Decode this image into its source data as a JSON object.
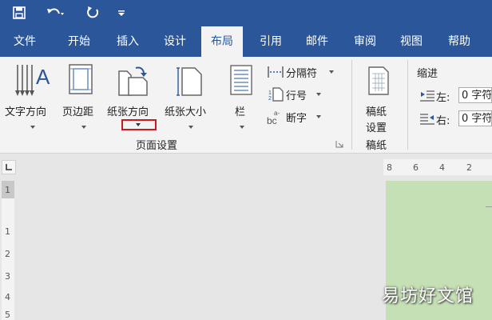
{
  "quick_access": {
    "save_icon": "save-icon",
    "undo_icon": "undo-icon",
    "redo_icon": "redo-icon",
    "customize_icon": "customize-dropdown-icon"
  },
  "tabs": [
    {
      "label": "文件"
    },
    {
      "label": "开始"
    },
    {
      "label": "插入"
    },
    {
      "label": "设计"
    },
    {
      "label": "布局",
      "active": true
    },
    {
      "label": "引用"
    },
    {
      "label": "邮件"
    },
    {
      "label": "审阅"
    },
    {
      "label": "视图"
    },
    {
      "label": "帮助"
    }
  ],
  "ribbon": {
    "page_setup": {
      "text_direction": "文字方向",
      "margins": "页边距",
      "orientation": "纸张方向",
      "size": "纸张大小",
      "columns": "栏",
      "breaks": "分隔符",
      "line_numbers": "行号",
      "hyphenation": "断字",
      "group_label": "页面设置"
    },
    "manuscript": {
      "button": "稿纸",
      "button_line2": "设置",
      "group_label": "稿纸"
    },
    "indent": {
      "title": "缩进",
      "left_label": "左:",
      "right_label": "右:",
      "left_value": "0 字符",
      "right_value": "0 字符"
    }
  },
  "ruler": {
    "horizontal_ticks": [
      "8",
      "6",
      "4",
      "2"
    ],
    "vertical_ticks": [
      "1",
      "1",
      "2",
      "3",
      "4",
      "5"
    ]
  },
  "watermark": "易坊好文馆",
  "colors": {
    "brand": "#2b579a",
    "ribbon": "#f3f3f3",
    "page": "#c5e0b4",
    "highlight": "#d0181f"
  }
}
